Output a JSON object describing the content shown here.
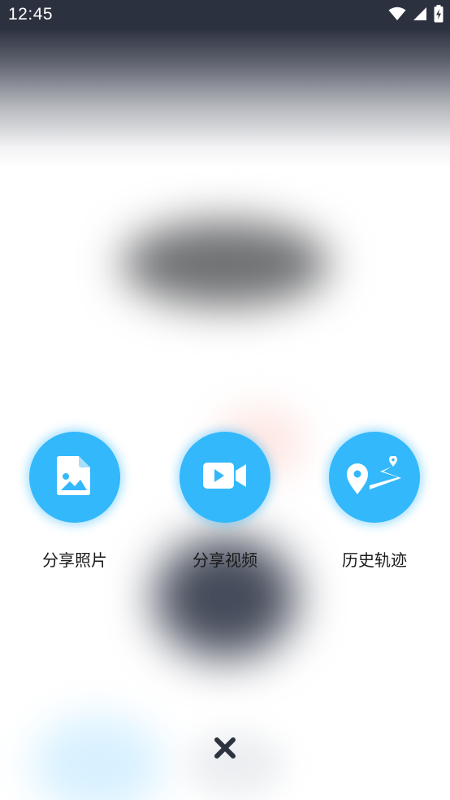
{
  "status_bar": {
    "time": "12:45",
    "icons": [
      "wifi-icon",
      "signal-icon",
      "battery-charging-icon"
    ]
  },
  "actions": [
    {
      "label": "分享照片",
      "icon": "photo-file-icon"
    },
    {
      "label": "分享视频",
      "icon": "video-camera-icon"
    },
    {
      "label": "历史轨迹",
      "icon": "location-track-icon"
    }
  ],
  "close": {
    "icon": "close-icon"
  },
  "colors": {
    "accent": "#33b8fb",
    "status_bar_bg": "#2c313f",
    "close_icon": "#2e3340"
  }
}
